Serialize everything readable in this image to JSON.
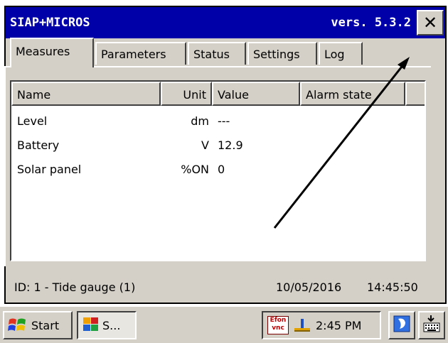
{
  "window": {
    "title": "SIAP+MICROS",
    "version": "vers. 5.3.2",
    "close_label": "✕"
  },
  "tabs": [
    {
      "label": "Measures",
      "active": true
    },
    {
      "label": "Parameters",
      "active": false
    },
    {
      "label": "Status",
      "active": false
    },
    {
      "label": "Settings",
      "active": false
    },
    {
      "label": "Log",
      "active": false
    }
  ],
  "table": {
    "columns": [
      "Name",
      "Unit",
      "Value",
      "Alarm state",
      ""
    ],
    "rows": [
      {
        "name": "Level",
        "unit": "dm",
        "value": "---",
        "alarm": ""
      },
      {
        "name": "Battery",
        "unit": "V",
        "value": "12.9",
        "alarm": ""
      },
      {
        "name": "Solar panel",
        "unit": "%ON",
        "value": "0",
        "alarm": ""
      }
    ]
  },
  "status": {
    "station": "ID: 1 - Tide gauge (1)",
    "date": "10/05/2016",
    "time": "14:45:50"
  },
  "taskbar": {
    "start_label": "Start",
    "task_label": "S...",
    "vnc_top": "Efon",
    "vnc_bottom": "vnc",
    "clock": "2:45 PM"
  },
  "colors": {
    "titlebar": "#0000a8",
    "window_face": "#d4d0c8",
    "annotation_arrow": "#000000"
  },
  "icons": [
    "close-icon",
    "windows-flag-icon",
    "app-icon",
    "vnc-icon",
    "network-icon",
    "desktop-icon",
    "keyboard-icon"
  ]
}
